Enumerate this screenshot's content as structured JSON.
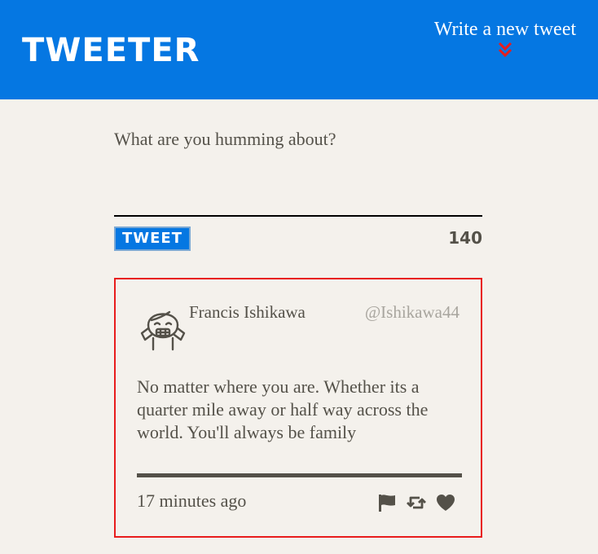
{
  "header": {
    "logo": "TWEETER",
    "write_label": "Write a new tweet",
    "chevron_icon": "double-chevron-down-icon",
    "background_color": "#0577e2",
    "chevron_color": "#e81c1c"
  },
  "composer": {
    "placeholder": "What are you humming about?",
    "value": "",
    "button_label": "TWEET",
    "char_count": "140"
  },
  "tweets": [
    {
      "name": "Francis Ishikawa",
      "handle": "@Ishikawa44",
      "avatar_icon": "girl-avatar-icon",
      "text": "No matter where you are. Whether its a quarter mile away or half way across the world. You'll always be family",
      "timestamp": "17 minutes ago",
      "actions": [
        "flag-icon",
        "retweet-icon",
        "heart-icon"
      ]
    }
  ],
  "colors": {
    "page_background": "#f4f1ec",
    "text": "#545149",
    "handle": "#a8a59e",
    "card_border": "#e81c1c"
  }
}
